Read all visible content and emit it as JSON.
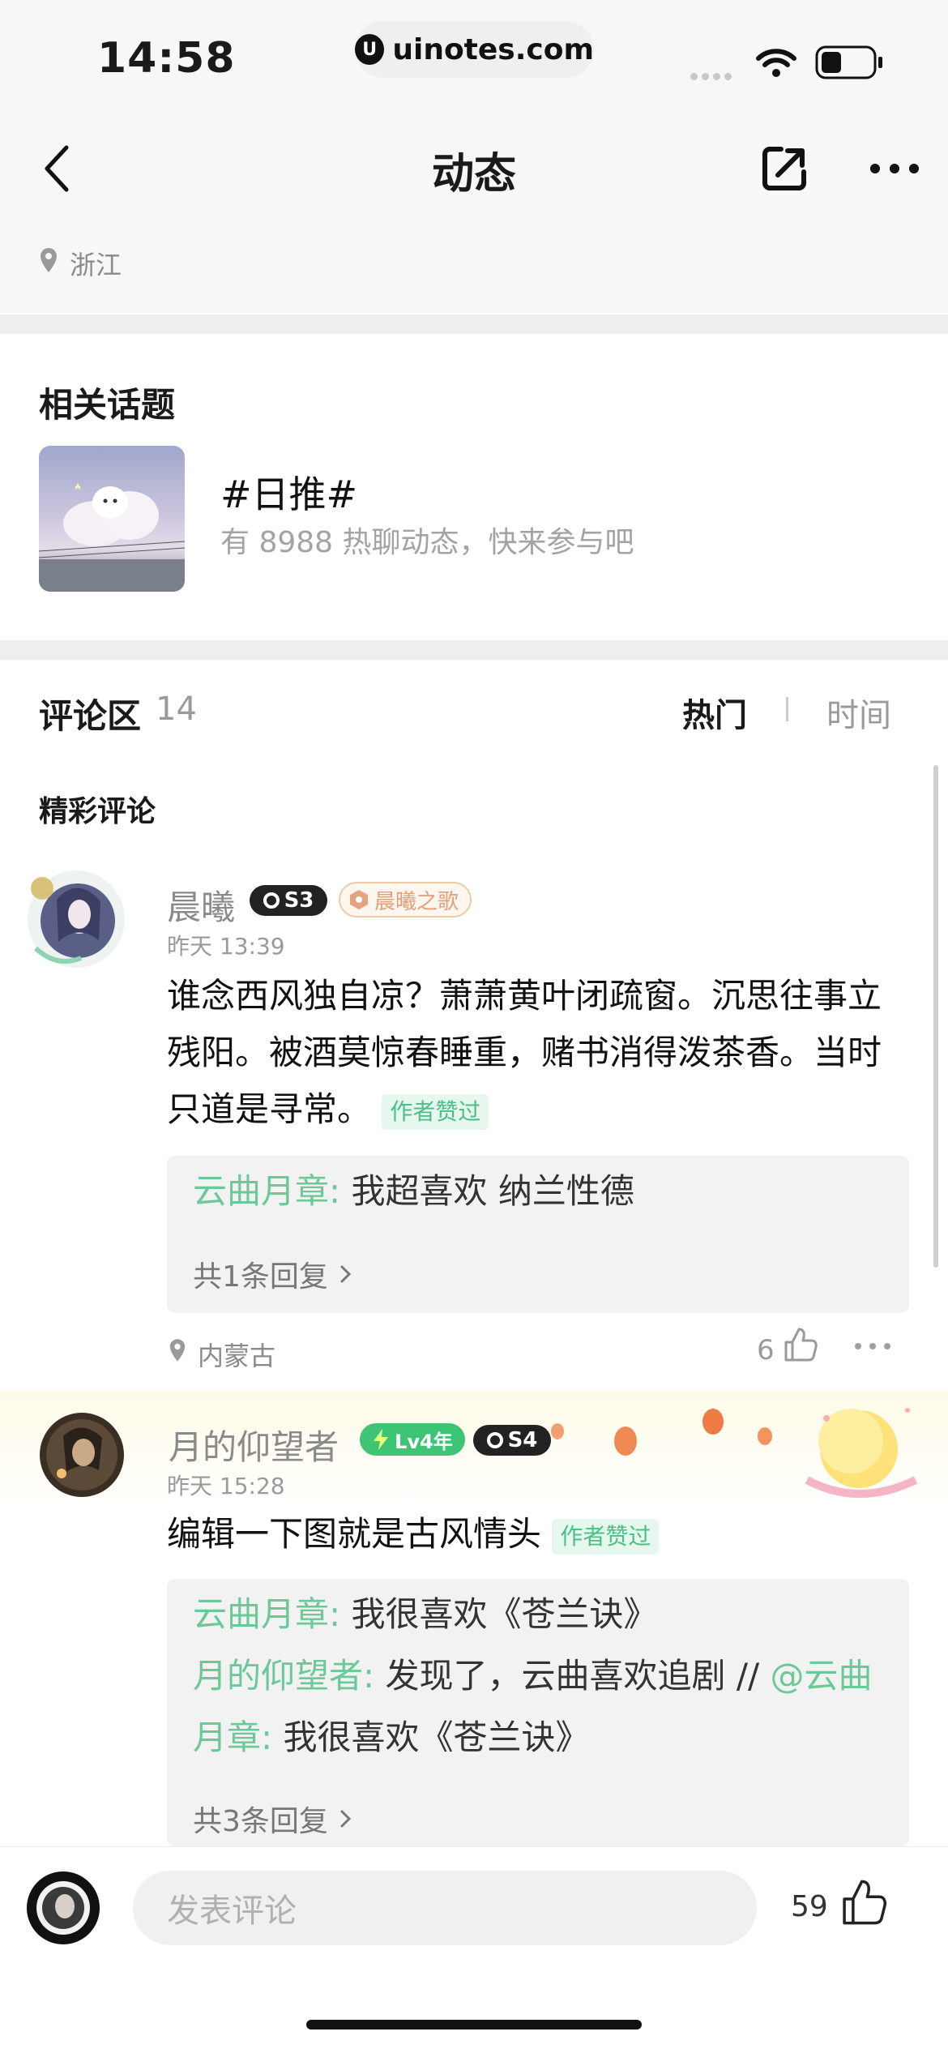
{
  "status_bar": {
    "time": "14:58",
    "url": "uinotes.com"
  },
  "nav": {
    "title": "动态"
  },
  "location": {
    "text": "浙江"
  },
  "topics": {
    "heading": "相关话题",
    "items": [
      {
        "title": "#日推#",
        "subtitle": "有 8988 热聊动态，快来参与吧"
      }
    ]
  },
  "comments_section": {
    "heading": "评论区",
    "count": "14",
    "sort_hot": "热门",
    "sort_time": "时间",
    "featured_label": "精彩评论"
  },
  "comments": [
    {
      "username": "晨曦",
      "season_badge": "S3",
      "fan_badge": "晨曦之歌",
      "time": "昨天 13:39",
      "text": "谁念西风独自凉？萧萧黄叶闭疏窗。沉思往事立残阳。被酒莫惊春睡重，赌书消得泼茶香。当时只道是寻常。",
      "author_liked": "作者赞过",
      "replies": [
        {
          "user": "云曲月章:",
          "text": "我超喜欢 纳兰性德"
        }
      ],
      "reply_total": "共1条回复",
      "location": "内蒙古",
      "likes": "6"
    },
    {
      "username": "月的仰望者",
      "level_badge": "Lv4年",
      "season_badge": "S4",
      "time": "昨天 15:28",
      "text": "编辑一下图就是古风情头",
      "author_liked": "作者赞过",
      "replies": [
        {
          "user": "云曲月章:",
          "text": "我很喜欢《苍兰诀》"
        },
        {
          "user": "月的仰望者:",
          "text": "发现了，云曲喜欢追剧 //",
          "mention": "@云曲月章:",
          "mention_text": "我很喜欢《苍兰诀》"
        }
      ],
      "reply_total": "共3条回复"
    }
  ],
  "bottom_bar": {
    "input_placeholder": "发表评论",
    "like_count": "59"
  },
  "colors": {
    "accent_green": "#6cc997",
    "text_gray": "#8a8a8a",
    "background_gray": "#f7f7f7"
  }
}
